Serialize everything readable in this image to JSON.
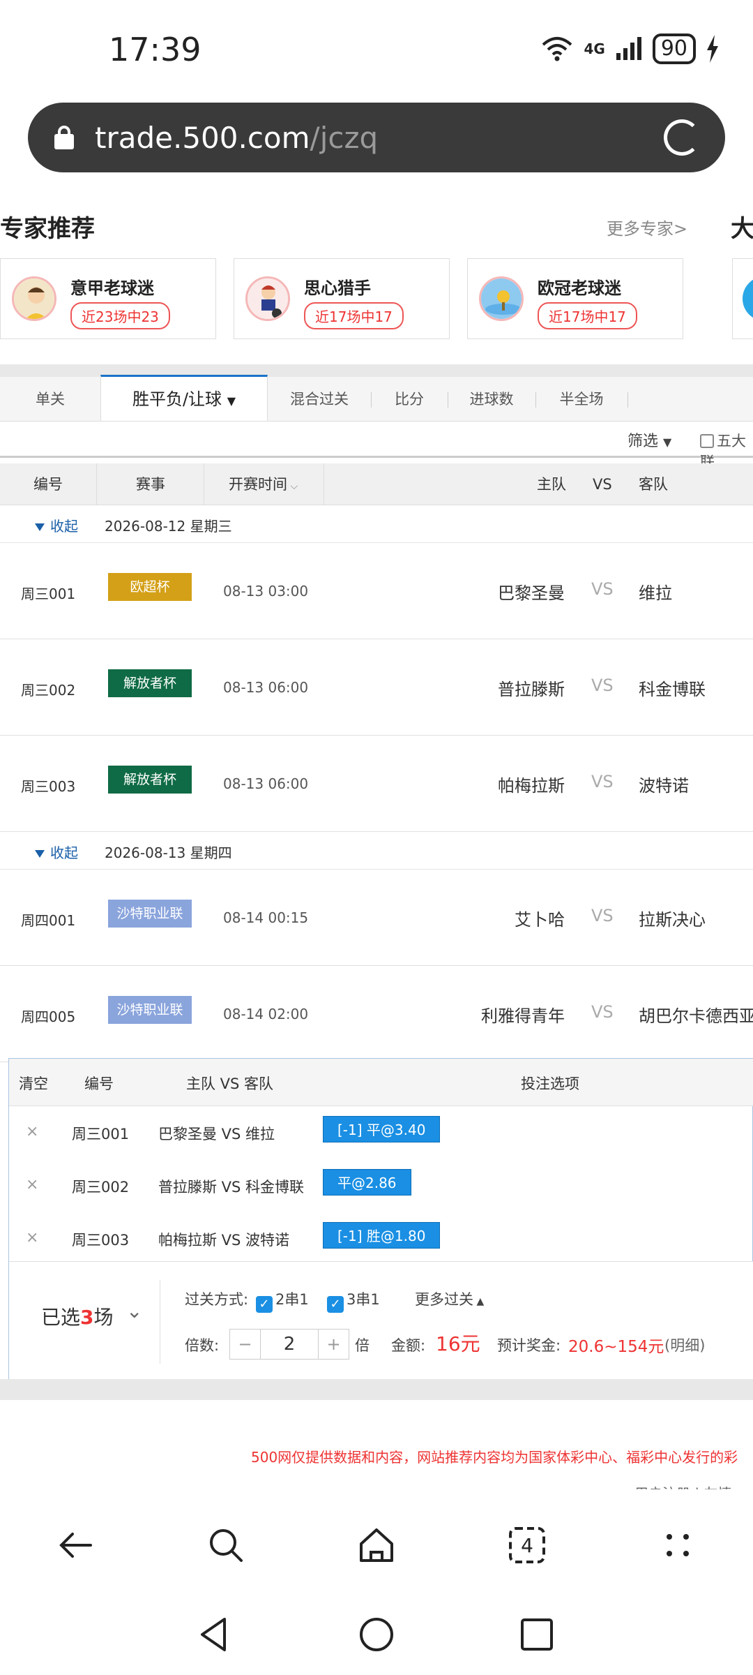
{
  "status": {
    "time": "17:39",
    "network": "4G",
    "battery": "90"
  },
  "url": {
    "host": "trade.500.com",
    "path": "/jczq"
  },
  "experts": {
    "title": "专家推荐",
    "more": "更多专家>",
    "next_title": "大",
    "cards": [
      {
        "name": "意甲老球迷",
        "badge": "近23场中23"
      },
      {
        "name": "思心猎手",
        "badge": "近17场中17"
      },
      {
        "name": "欧冠老球迷",
        "badge": "近17场中17"
      }
    ]
  },
  "tabs": [
    {
      "label": "单关"
    },
    {
      "label": "胜平负/让球"
    },
    {
      "label": "混合过关"
    },
    {
      "label": "比分"
    },
    {
      "label": "进球数"
    },
    {
      "label": "半全场"
    }
  ],
  "filter": {
    "label": "筛选",
    "five_leagues": "五大联"
  },
  "table_header": {
    "num": "编号",
    "league": "赛事",
    "time": "开赛时间",
    "home": "主队",
    "vs": "VS",
    "away": "客队"
  },
  "date_groups": [
    {
      "toggle": "收起",
      "date": "2026-08-12 星期三"
    },
    {
      "toggle": "收起",
      "date": "2026-08-13 星期四"
    }
  ],
  "matches": [
    {
      "num": "周三001",
      "league": "欧超杯",
      "league_color": "#d4a017",
      "time": "08-13 03:00",
      "home": "巴黎圣曼",
      "vs": "VS",
      "away": "维拉"
    },
    {
      "num": "周三002",
      "league": "解放者杯",
      "league_color": "#0f6b45",
      "time": "08-13 06:00",
      "home": "普拉滕斯",
      "vs": "VS",
      "away": "科金博联"
    },
    {
      "num": "周三003",
      "league": "解放者杯",
      "league_color": "#0f6b45",
      "time": "08-13 06:00",
      "home": "帕梅拉斯",
      "vs": "VS",
      "away": "波特诺"
    },
    {
      "num": "周四001",
      "league": "沙特职业联",
      "league_color": "#8aa4dc",
      "time": "08-14 00:15",
      "home": "艾卜哈",
      "vs": "VS",
      "away": "拉斯决心"
    },
    {
      "num": "周四005",
      "league": "沙特职业联",
      "league_color": "#8aa4dc",
      "time": "08-14 02:00",
      "home": "利雅得青年",
      "vs": "VS",
      "away": "胡巴尔卡德西亚"
    }
  ],
  "slip": {
    "header": {
      "clear": "清空",
      "num": "编号",
      "teams": "主队 VS 客队",
      "options": "投注选项"
    },
    "rows": [
      {
        "num": "周三001",
        "teams": "巴黎圣曼 VS 维拉",
        "selection": "[-1] 平@3.40"
      },
      {
        "num": "周三002",
        "teams": "普拉滕斯 VS 科金博联",
        "selection": "平@2.86"
      },
      {
        "num": "周三003",
        "teams": "帕梅拉斯 VS 波特诺",
        "selection": "[-1] 胜@1.80"
      }
    ],
    "selected_prefix": "已选",
    "selected_count": "3",
    "selected_suffix": "场",
    "pass_label": "过关方式:",
    "pass1": "2串1",
    "pass2": "3串1",
    "more_pass": "更多过关",
    "multiplier_label": "倍数:",
    "multiplier": "2",
    "multiplier_unit": "倍",
    "amount_label": "金额:",
    "amount": "16元",
    "prize_label": "预计奖金:",
    "prize": "20.6~154元",
    "detail": "(明细)"
  },
  "notice": "500网仅提供数据和内容，网站推荐内容均为国家体彩中心、福彩中心发行的彩",
  "footer_links": "用户注册 | 友情"
}
